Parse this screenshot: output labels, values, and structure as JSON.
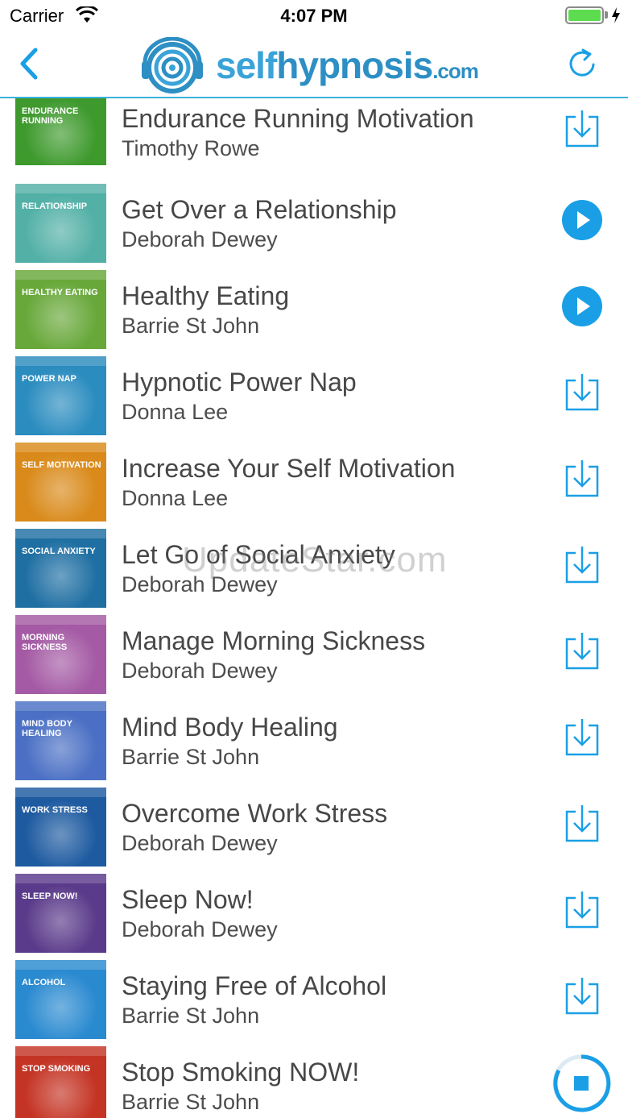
{
  "status_bar": {
    "carrier": "Carrier",
    "time": "4:07 PM"
  },
  "nav": {
    "logo_self": "self",
    "logo_hypnosis": "hypnosis",
    "logo_dotcom": ".com",
    "back_icon": "chevron-left-icon",
    "refresh_icon": "refresh-icon"
  },
  "accent_color": "#1a9fe6",
  "tracks": [
    {
      "title": "Endurance Running Motivation",
      "author": "Timothy Rowe",
      "cover_title": "Endurance Running",
      "cover_color": "#3f9a2e",
      "action": "download"
    },
    {
      "title": "Get Over a Relationship",
      "author": "Deborah Dewey",
      "cover_title": "Relationship",
      "cover_color": "#52b0a6",
      "action": "play"
    },
    {
      "title": "Healthy Eating",
      "author": "Barrie St John",
      "cover_title": "Healthy Eating",
      "cover_color": "#68a83a",
      "action": "play"
    },
    {
      "title": "Hypnotic Power Nap",
      "author": "Donna Lee",
      "cover_title": "Power Nap",
      "cover_color": "#2a8cbf",
      "action": "download"
    },
    {
      "title": "Increase Your Self Motivation",
      "author": "Donna Lee",
      "cover_title": "Self Motivation",
      "cover_color": "#d98a1a",
      "action": "download"
    },
    {
      "title": "Let Go of Social Anxiety",
      "author": "Deborah Dewey",
      "cover_title": "Social Anxiety",
      "cover_color": "#1f6fa3",
      "action": "download"
    },
    {
      "title": "Manage Morning Sickness",
      "author": "Deborah Dewey",
      "cover_title": "Morning Sickness",
      "cover_color": "#a45aa4",
      "action": "download"
    },
    {
      "title": "Mind Body Healing",
      "author": "Barrie St John",
      "cover_title": "Mind Body Healing",
      "cover_color": "#4a6fc4",
      "action": "download"
    },
    {
      "title": "Overcome Work Stress",
      "author": "Deborah Dewey",
      "cover_title": "Work Stress",
      "cover_color": "#1d5aa0",
      "action": "download"
    },
    {
      "title": "Sleep Now!",
      "author": "Deborah Dewey",
      "cover_title": "Sleep Now!",
      "cover_color": "#5a3a8a",
      "action": "download"
    },
    {
      "title": "Staying Free of Alcohol",
      "author": "Barrie St John",
      "cover_title": "Alcohol",
      "cover_color": "#2a8ad0",
      "action": "download"
    },
    {
      "title": "Stop Smoking NOW!",
      "author": "Barrie St John",
      "cover_title": "Stop Smoking",
      "cover_color": "#c43424",
      "action": "stop"
    }
  ],
  "watermark": "UpdateStar.com"
}
